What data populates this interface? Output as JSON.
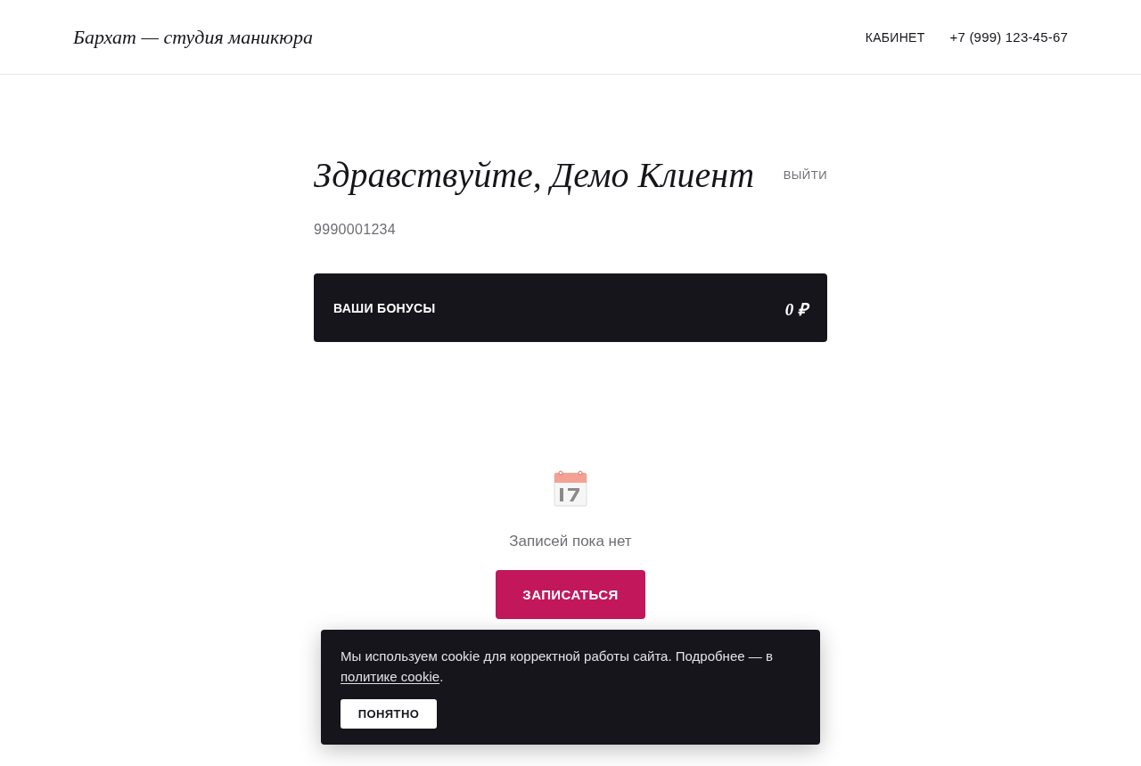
{
  "header": {
    "logo": "Бархат — студия маникюра",
    "nav": [
      "КАБИНЕТ",
      "+7 (999) 123-45-67"
    ]
  },
  "profile": {
    "greeting": "Здравствуйте, Демо Клиент",
    "logout": "ВЫЙТИ",
    "phone": "9990001234"
  },
  "bonus_card": {
    "label": "ВАШИ БОНУСЫ",
    "amount": "0 ₽"
  },
  "appointments": {
    "empty_text": "Записей пока нет",
    "button": "ЗАПИСАТЬСЯ"
  },
  "cookie_banner": {
    "text": "Мы используем cookie для корректной работы сайта. Подробнее — в ",
    "link": "политике cookie",
    "text_after": ".",
    "button": "ПОНЯТНО"
  }
}
